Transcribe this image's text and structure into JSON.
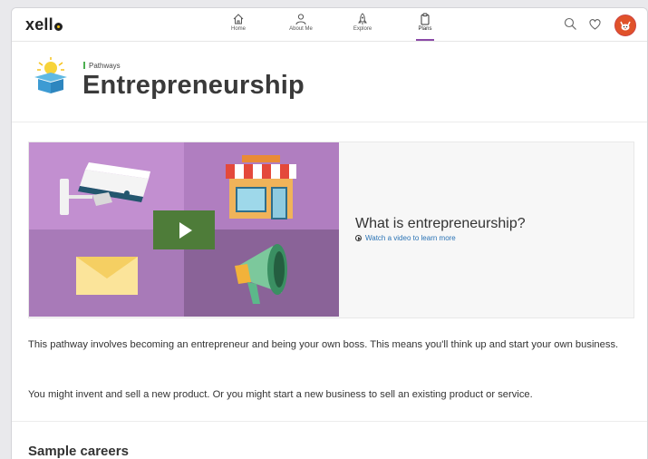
{
  "app": {
    "logo": "xello"
  },
  "nav": {
    "items": [
      {
        "label": "Home",
        "icon": "home-icon"
      },
      {
        "label": "About Me",
        "icon": "person-icon"
      },
      {
        "label": "Explore",
        "icon": "rocket-icon"
      },
      {
        "label": "Plans",
        "icon": "clipboard-icon",
        "active": true
      }
    ],
    "right_icons": [
      "search-icon",
      "heart-icon",
      "avatar"
    ]
  },
  "header": {
    "breadcrumb": "Pathways",
    "title": "Entrepreneurship",
    "icon": "lightbulb-box-icon"
  },
  "video_card": {
    "title": "What is entrepreneurship?",
    "link": "Watch a video to learn more"
  },
  "body": {
    "paragraph1": "This pathway involves becoming an entrepreneur and being your own boss. This means you'll think up and start your own business.",
    "paragraph2": "You might invent and sell a new product. Or you might start a new business to sell an existing product or service.",
    "section_title": "Sample careers"
  },
  "colors": {
    "accent": "#8b4aa7",
    "link": "#2a73b5",
    "play": "#4e7c39",
    "avatar": "#e0522a"
  }
}
